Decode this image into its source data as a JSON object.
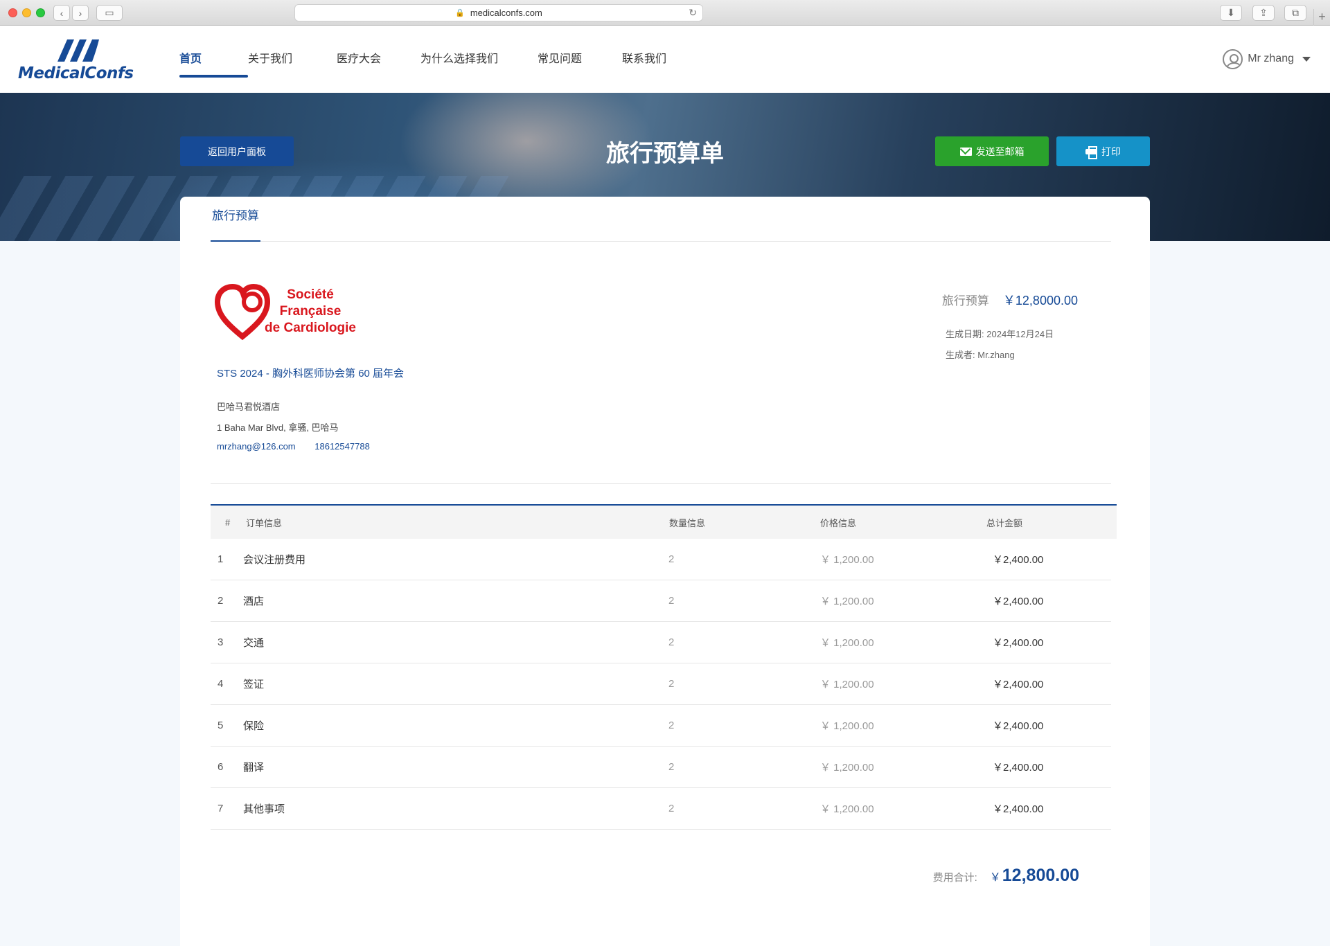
{
  "browser": {
    "url": "medicalconfs.com"
  },
  "brand": {
    "name": "MedicalConfs",
    "color": "#164a96"
  },
  "nav": {
    "items": [
      {
        "label": "首页",
        "active": true
      },
      {
        "label": "关于我们",
        "active": false
      },
      {
        "label": "医疗大会",
        "active": false
      },
      {
        "label": "为什么选择我们",
        "active": false
      },
      {
        "label": "常见问题",
        "active": false
      },
      {
        "label": "联系我们",
        "active": false
      }
    ]
  },
  "user": {
    "name": "Mr zhang"
  },
  "banner": {
    "title": "旅行预算单",
    "back_label": "返回用户面板",
    "mail_label": "发送至邮箱",
    "print_label": "打印"
  },
  "tab": {
    "label": "旅行预算"
  },
  "organizer": {
    "logo_text": [
      "Société",
      "Française",
      "de Cardiologie"
    ],
    "logo_color": "#d9171e"
  },
  "conference": {
    "title": "STS 2024 - 胸外科医师协会第 60 届年会",
    "hotel": "巴哈马君悦酒店",
    "address": "1 Baha Mar Blvd, 拿骚, 巴哈马",
    "email": "mrzhang@126.com",
    "phone": "18612547788"
  },
  "summary": {
    "budget_label": "旅行预算",
    "budget_value": "￥12,8000.00",
    "date_label": "生成日期:",
    "date_value": "2024年12月24日",
    "author_label": "生成者:",
    "author_value": "Mr.zhang"
  },
  "table": {
    "headers": {
      "num": "#",
      "name": "订单信息",
      "qty": "数量信息",
      "price": "价格信息",
      "total": "总计金额"
    },
    "rows": [
      {
        "num": "1",
        "name": "会议注册费用",
        "qty": "2",
        "price": "￥ 1,200.00",
        "total": "￥2,400.00"
      },
      {
        "num": "2",
        "name": "酒店",
        "qty": "2",
        "price": "￥ 1,200.00",
        "total": "￥2,400.00"
      },
      {
        "num": "3",
        "name": "交通",
        "qty": "2",
        "price": "￥ 1,200.00",
        "total": "￥2,400.00"
      },
      {
        "num": "4",
        "name": "签证",
        "qty": "2",
        "price": "￥ 1,200.00",
        "total": "￥2,400.00"
      },
      {
        "num": "5",
        "name": "保险",
        "qty": "2",
        "price": "￥ 1,200.00",
        "total": "￥2,400.00"
      },
      {
        "num": "6",
        "name": "翻译",
        "qty": "2",
        "price": "￥ 1,200.00",
        "total": "￥2,400.00"
      },
      {
        "num": "7",
        "name": "其他事项",
        "qty": "2",
        "price": "￥ 1,200.00",
        "total": "￥2,400.00"
      }
    ]
  },
  "total": {
    "label": "费用合计:",
    "currency": "￥",
    "amount": "12,800.00"
  },
  "colors": {
    "primary": "#164a96",
    "mail_button": "#2aa22c",
    "print_button": "#1592c8"
  }
}
